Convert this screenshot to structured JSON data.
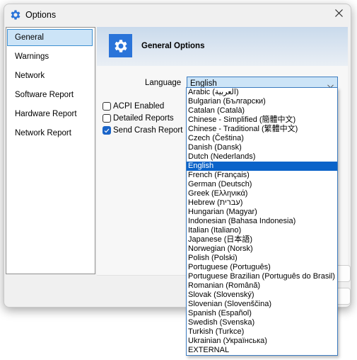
{
  "window": {
    "title": "Options",
    "title_icon": "gear-icon",
    "close_icon": "close-icon"
  },
  "nav": {
    "items": [
      {
        "label": "General",
        "selected": true
      },
      {
        "label": "Warnings",
        "selected": false
      },
      {
        "label": "Network",
        "selected": false
      },
      {
        "label": "Software Report",
        "selected": false
      },
      {
        "label": "Hardware Report",
        "selected": false
      },
      {
        "label": "Network Report",
        "selected": false
      }
    ]
  },
  "content": {
    "banner_title": "General Options",
    "banner_icon": "gear-icon",
    "language_label": "Language",
    "language_selected": "English",
    "checkboxes": [
      {
        "label": "ACPI Enabled",
        "checked": false
      },
      {
        "label": "Detailed Reports",
        "checked": false
      },
      {
        "label": "Send Crash Report",
        "checked": true
      }
    ]
  },
  "dropdown": {
    "options": [
      "Arabic (العربية)",
      "Bulgarian (Български)",
      "Catalan (Català)",
      "Chinese - Simplified (簡體中文)",
      "Chinese - Traditional (繁體中文)",
      "Czech (Čeština)",
      "Danish (Dansk)",
      "Dutch (Nederlands)",
      "English",
      "French (Français)",
      "German (Deutsch)",
      "Greek (Ελληνικά)",
      "Hebrew (עברית)",
      "Hungarian (Magyar)",
      "Indonesian (Bahasa Indonesia)",
      "Italian (Italiano)",
      "Japanese (日本語)",
      "Norwegian (Norsk)",
      "Polish (Polski)",
      "Portuguese (Português)",
      "Portuguese Brazilian (Português do Brasil)",
      "Romanian (Română)",
      "Slovak (Slovenský)",
      "Slovenian (Slovenščina)",
      "Spanish (Español)",
      "Swedish (Svenska)",
      "Turkish (Turkce)",
      "Ukrainian (Українська)",
      "EXTERNAL"
    ],
    "selected_index": 8
  },
  "colors": {
    "accent": "#0a63c9",
    "selection_bg": "#cce4f7",
    "icon_blue": "#2a74d9"
  }
}
